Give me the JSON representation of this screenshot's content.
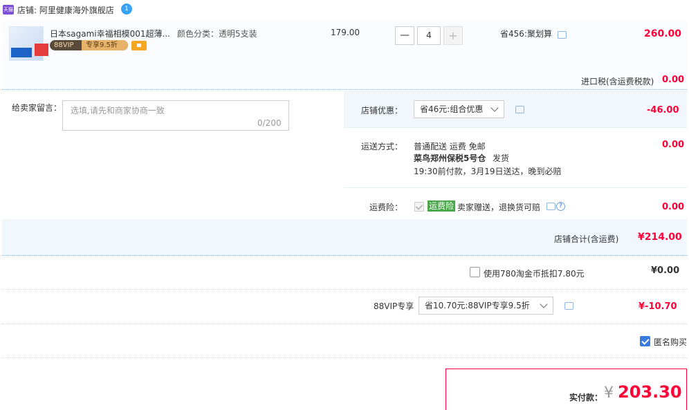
{
  "store": {
    "label": "店铺: 阿里健康海外旗舰店",
    "logo_text": "天猫",
    "badge_count": "1"
  },
  "item": {
    "title": "日本sagami幸福相模001超薄...",
    "vip_label": "88VIP",
    "vip_discount": "专享9.5折",
    "sku": "颜色分类：透明5支装",
    "unit_price": "179.00",
    "quantity": "4",
    "minus_label": "—",
    "plus_label": "+",
    "savings": "省456:聚划算",
    "total": "260.00",
    "import_tax_label": "进口税(含运费税款)",
    "import_tax_value": "0.00"
  },
  "message": {
    "label": "给卖家留言：",
    "placeholder": "选填,请先和商家协商一致",
    "counter": "0/200"
  },
  "store_discount": {
    "label": "店铺优惠：",
    "selected": "省46元:组合优惠",
    "value": "-46.00"
  },
  "shipping": {
    "label": "运送方式：",
    "method": "普通配送 运费 免邮",
    "warehouse": "菜鸟郑州保税5号仓",
    "dispatch": "发货",
    "delivery": "19:30前付款，3月19日送达，晚到必赔",
    "value": "0.00"
  },
  "insurance": {
    "label": "运费险：",
    "badge": "运费险",
    "desc": "卖家赠送，退换货可赔",
    "help": "?",
    "value": "0.00"
  },
  "store_total": {
    "label": "店铺合计(含运费)",
    "value": "¥214.00"
  },
  "coins": {
    "label": "使用780淘金币抵扣7.80元",
    "value": "¥0.00"
  },
  "vip": {
    "label": "88VIP专享",
    "selected": "省10.70元:88VIP专享9.5折",
    "value": "¥-10.70"
  },
  "anonymous": {
    "label": "匿名购买"
  },
  "final": {
    "label": "实付款：",
    "currency": "¥",
    "value": "203.30"
  },
  "colors": {
    "price_red": "#ff0036",
    "light_blue_bg": "#f2f7fd",
    "checkbox_blue": "#3b7bde",
    "insurance_green": "#4aa64a"
  }
}
